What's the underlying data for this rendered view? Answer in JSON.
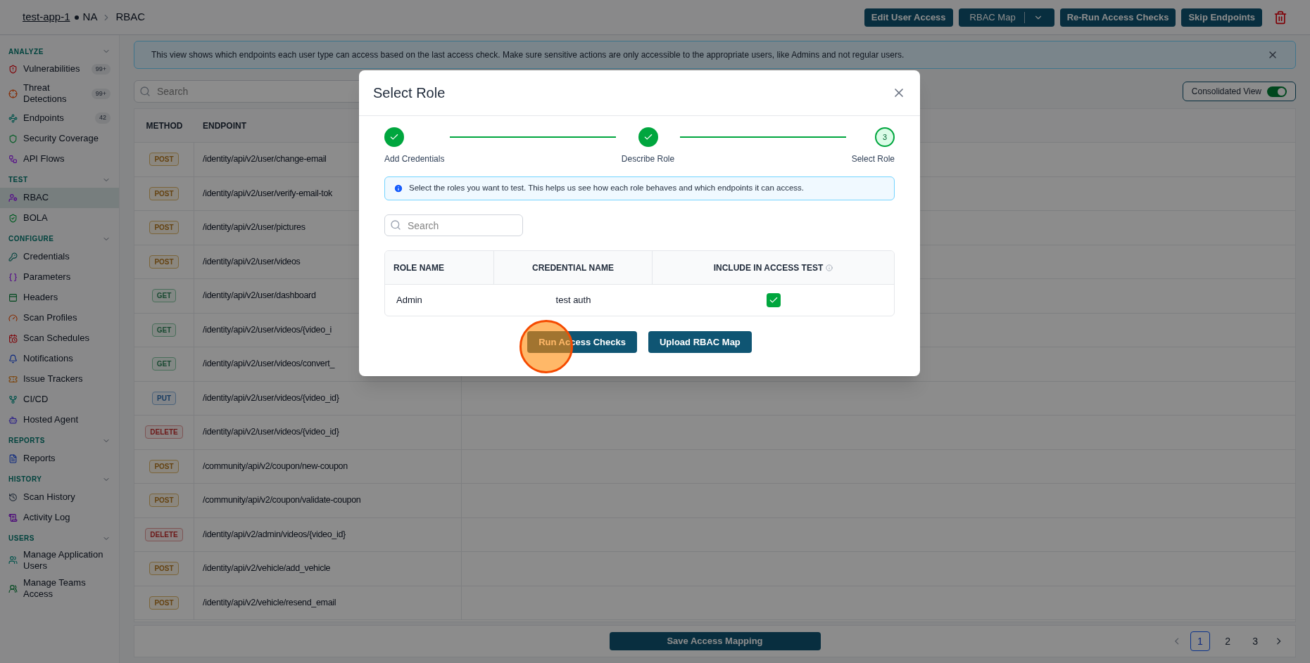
{
  "breadcrumb": {
    "app": "test-app-1",
    "env": "NA",
    "page": "RBAC"
  },
  "header_buttons": [
    {
      "label": "Edit User Access",
      "kind": "button"
    },
    {
      "label": "RBAC Map",
      "kind": "split"
    },
    {
      "label": "Re-Run Access Checks",
      "kind": "button"
    },
    {
      "label": "Skip Endpoints",
      "kind": "button"
    }
  ],
  "sidebar": {
    "sections": [
      {
        "title": "ANALYZE",
        "expanded": true,
        "items": [
          {
            "label": "Vulnerabilities",
            "badge": "99+",
            "selected": false
          },
          {
            "label": "Threat Detections",
            "badge": "99+",
            "selected": false
          },
          {
            "label": "Endpoints",
            "badge": "42",
            "selected": false
          },
          {
            "label": "Security Coverage",
            "selected": false
          },
          {
            "label": "API Flows",
            "selected": false
          }
        ]
      },
      {
        "title": "TEST",
        "expanded": true,
        "items": [
          {
            "label": "RBAC",
            "selected": true
          },
          {
            "label": "BOLA",
            "selected": false
          }
        ]
      },
      {
        "title": "CONFIGURE",
        "expanded": true,
        "items": [
          {
            "label": "Credentials",
            "selected": false
          },
          {
            "label": "Parameters",
            "selected": false
          },
          {
            "label": "Headers",
            "selected": false
          },
          {
            "label": "Scan Profiles",
            "selected": false
          },
          {
            "label": "Scan Schedules",
            "selected": false
          },
          {
            "label": "Notifications",
            "selected": false
          },
          {
            "label": "Issue Trackers",
            "selected": false
          },
          {
            "label": "CI/CD",
            "selected": false
          },
          {
            "label": "Hosted Agent",
            "selected": false
          }
        ]
      },
      {
        "title": "REPORTS",
        "expanded": true,
        "items": [
          {
            "label": "Reports",
            "selected": false
          }
        ]
      },
      {
        "title": "HISTORY",
        "expanded": true,
        "items": [
          {
            "label": "Scan History",
            "selected": false
          },
          {
            "label": "Activity Log",
            "selected": false
          }
        ]
      },
      {
        "title": "USERS",
        "expanded": true,
        "items": [
          {
            "label": "Manage Application Users",
            "selected": false
          },
          {
            "label": "Manage Teams Access",
            "selected": false
          }
        ]
      }
    ]
  },
  "banner": {
    "text": "This view shows which endpoints each user type can access based on the last access check. Make sure sensitive actions are only accessible to the appropriate users, like Admins and not regular users."
  },
  "search": {
    "placeholder": "Search"
  },
  "consolidated_view": {
    "label": "Consolidated View",
    "on": true
  },
  "table": {
    "columns": [
      "METHOD",
      "ENDPOINT"
    ],
    "rows": [
      {
        "method": "POST",
        "kind": "post",
        "endpoint": "/identity/api/v2/user/change-email"
      },
      {
        "method": "POST",
        "kind": "post",
        "endpoint": "/identity/api/v2/user/verify-email-tok"
      },
      {
        "method": "POST",
        "kind": "post",
        "endpoint": "/identity/api/v2/user/pictures"
      },
      {
        "method": "POST",
        "kind": "post",
        "endpoint": "/identity/api/v2/user/videos"
      },
      {
        "method": "GET",
        "kind": "get",
        "endpoint": "/identity/api/v2/user/dashboard"
      },
      {
        "method": "GET",
        "kind": "get",
        "endpoint": "/identity/api/v2/user/videos/{video_i"
      },
      {
        "method": "GET",
        "kind": "get",
        "endpoint": "/identity/api/v2/user/videos/convert_"
      },
      {
        "method": "PUT",
        "kind": "put",
        "endpoint": "/identity/api/v2/user/videos/{video_id}"
      },
      {
        "method": "DELETE",
        "kind": "delete",
        "endpoint": "/identity/api/v2/user/videos/{video_id}"
      },
      {
        "method": "POST",
        "kind": "post",
        "endpoint": "/community/api/v2/coupon/new-coupon"
      },
      {
        "method": "POST",
        "kind": "post",
        "endpoint": "/community/api/v2/coupon/validate-coupon"
      },
      {
        "method": "DELETE",
        "kind": "delete",
        "endpoint": "/identity/api/v2/admin/videos/{video_id}"
      },
      {
        "method": "POST",
        "kind": "post",
        "endpoint": "/identity/api/v2/vehicle/add_vehicle"
      },
      {
        "method": "POST",
        "kind": "post",
        "endpoint": "/identity/api/v2/vehicle/resend_email"
      }
    ]
  },
  "footer": {
    "save_button": "Save Access Mapping",
    "pages": [
      {
        "label": "1",
        "selected": true
      },
      {
        "label": "2",
        "selected": false
      },
      {
        "label": "3",
        "selected": false
      }
    ]
  },
  "modal": {
    "title": "Select Role",
    "steps": [
      {
        "label": "Add Credentials",
        "done": true
      },
      {
        "label": "Describe Role",
        "done": true
      },
      {
        "label": "Select Role",
        "done": false,
        "number": "3"
      }
    ],
    "info": "Select the roles you want to test. This helps us see how each role behaves and which endpoints it can access.",
    "search_placeholder": "Search",
    "columns": [
      "ROLE NAME",
      "CREDENTIAL NAME",
      "INCLUDE IN ACCESS TEST"
    ],
    "rows": [
      {
        "role": "Admin",
        "credential": "test auth",
        "checked": true
      }
    ],
    "buttons": [
      "Run Access Checks",
      "Upload RBAC Map"
    ]
  }
}
